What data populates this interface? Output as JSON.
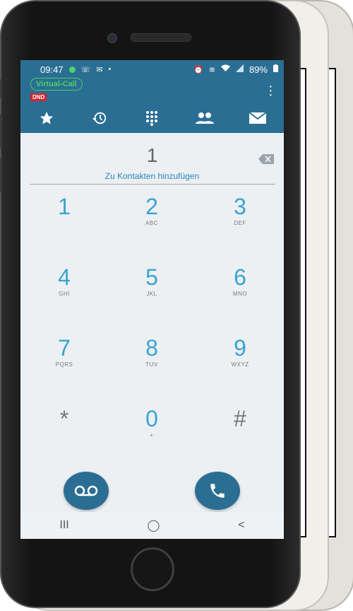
{
  "status_bar": {
    "time": "09:47",
    "battery": "89%"
  },
  "header": {
    "virtual_call_label": "Virtual-Call",
    "dnd_label": "DND",
    "menu_icon": "more-vert-icon"
  },
  "tabs": [
    {
      "name": "favorites",
      "icon": "star-icon"
    },
    {
      "name": "history",
      "icon": "history-icon"
    },
    {
      "name": "dialpad",
      "icon": "dialpad-icon",
      "active": true
    },
    {
      "name": "contacts",
      "icon": "contacts-icon"
    },
    {
      "name": "messages",
      "icon": "mail-icon"
    }
  ],
  "dialer": {
    "number": "1",
    "add_contact": "Zu Kontakten hinzufügen"
  },
  "keys": [
    {
      "digit": "1",
      "letters": ""
    },
    {
      "digit": "2",
      "letters": "ABC"
    },
    {
      "digit": "3",
      "letters": "DEF"
    },
    {
      "digit": "4",
      "letters": "GHI"
    },
    {
      "digit": "5",
      "letters": "JKL"
    },
    {
      "digit": "6",
      "letters": "MNO"
    },
    {
      "digit": "7",
      "letters": "PQRS"
    },
    {
      "digit": "8",
      "letters": "TUV"
    },
    {
      "digit": "9",
      "letters": "WXYZ"
    },
    {
      "digit": "*",
      "letters": ""
    },
    {
      "digit": "0",
      "letters": "+"
    },
    {
      "digit": "#",
      "letters": ""
    }
  ],
  "actions": {
    "voicemail_icon": "voicemail-icon",
    "call_icon": "phone-icon"
  },
  "navbar": {
    "recent": "III",
    "home": "◯",
    "back": "<"
  },
  "colors": {
    "appbar": "#2b6e93",
    "accent": "#3aa3d0",
    "virtual_call": "#4ad060",
    "dnd": "#d5232f"
  }
}
